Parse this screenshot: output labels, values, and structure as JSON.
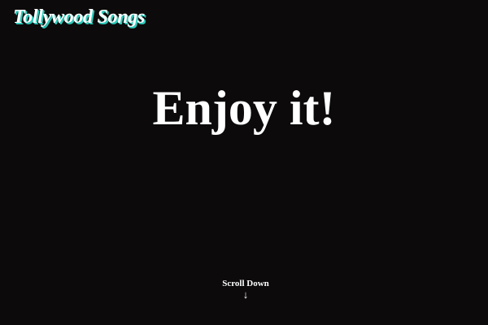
{
  "header": {
    "logo_text": "Tollywood Songs"
  },
  "hero": {
    "title": "Enjoy it!"
  },
  "scroll": {
    "label": "Scroll Down",
    "arrow_icon": "arrow-down-icon",
    "arrow_glyph": "↓"
  },
  "colors": {
    "background": "#0c0a0a",
    "text": "#ffffff",
    "logo_shadow": "#2fc9b9"
  }
}
